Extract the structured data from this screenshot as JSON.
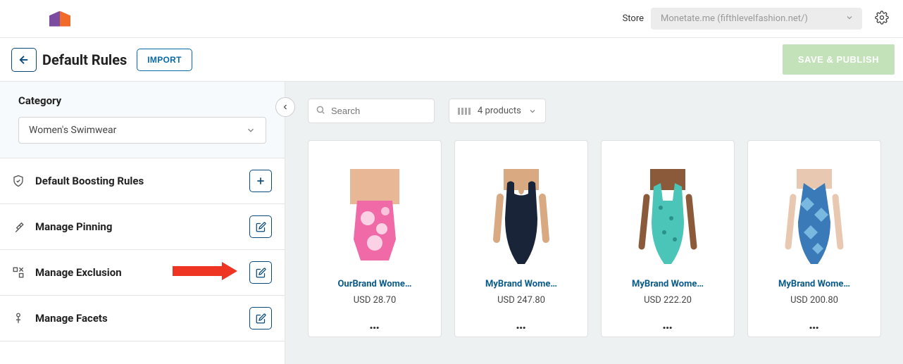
{
  "topbar": {
    "store_label": "Store",
    "store_value": "Monetate.me (fifthlevelfashion.net/)"
  },
  "header": {
    "title": "Default Rules",
    "import_label": "IMPORT",
    "save_label": "SAVE & PUBLISH"
  },
  "sidebar": {
    "category_title": "Category",
    "category_value": "Women's Swimwear",
    "rules": [
      {
        "label": "Default Boosting Rules",
        "action": "add"
      },
      {
        "label": "Manage Pinning",
        "action": "edit"
      },
      {
        "label": "Manage Exclusion",
        "action": "edit",
        "highlighted": true
      },
      {
        "label": "Manage Facets",
        "action": "edit"
      }
    ]
  },
  "content": {
    "search_placeholder": "Search",
    "products_count_label": "4 products",
    "products": [
      {
        "name": "OurBrand Wome…",
        "price": "USD 28.70"
      },
      {
        "name": "MyBrand Wome…",
        "price": "USD 247.80"
      },
      {
        "name": "MyBrand Wome…",
        "price": "USD 222.20"
      },
      {
        "name": "MyBrand Wome…",
        "price": "USD 200.80"
      }
    ]
  }
}
